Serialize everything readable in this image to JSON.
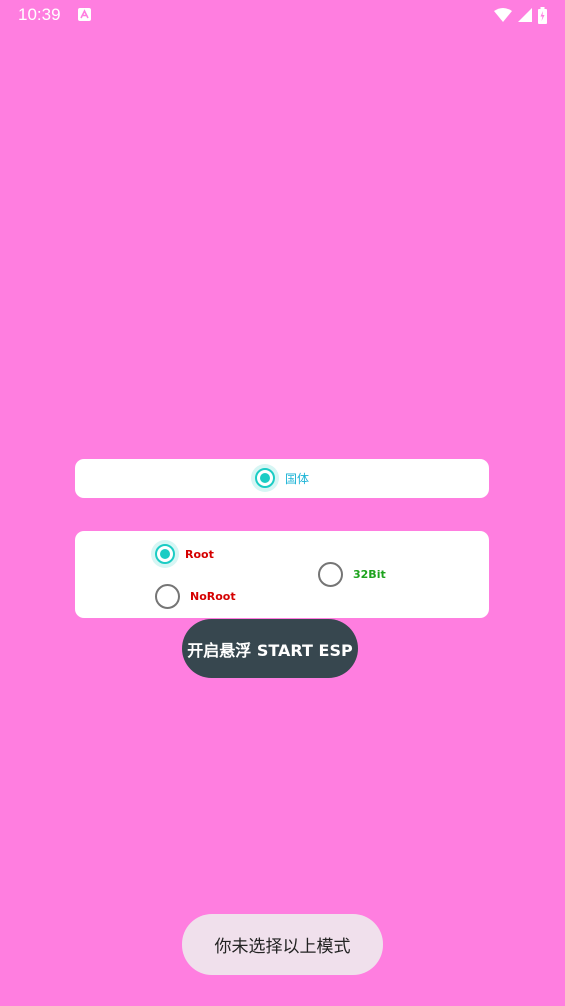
{
  "status_bar": {
    "time": "10:39"
  },
  "font_card": {
    "option": {
      "label": "国体",
      "checked": true,
      "color": "#1BB3D6"
    }
  },
  "mode_card": {
    "root": {
      "label": "Root",
      "checked": true,
      "color": "#D50000"
    },
    "noroot": {
      "label": "NoRoot",
      "checked": false,
      "color": "#D50000"
    },
    "bit32": {
      "label": "32Bit",
      "checked": false,
      "color": "#1EA31E"
    }
  },
  "start_button": {
    "label": "开启悬浮 START ESP"
  },
  "toast": {
    "message": "你未选择以上模式"
  },
  "colors": {
    "background": "#FF7EE0",
    "accent": "#1BCCC4",
    "button": "#37474F"
  }
}
